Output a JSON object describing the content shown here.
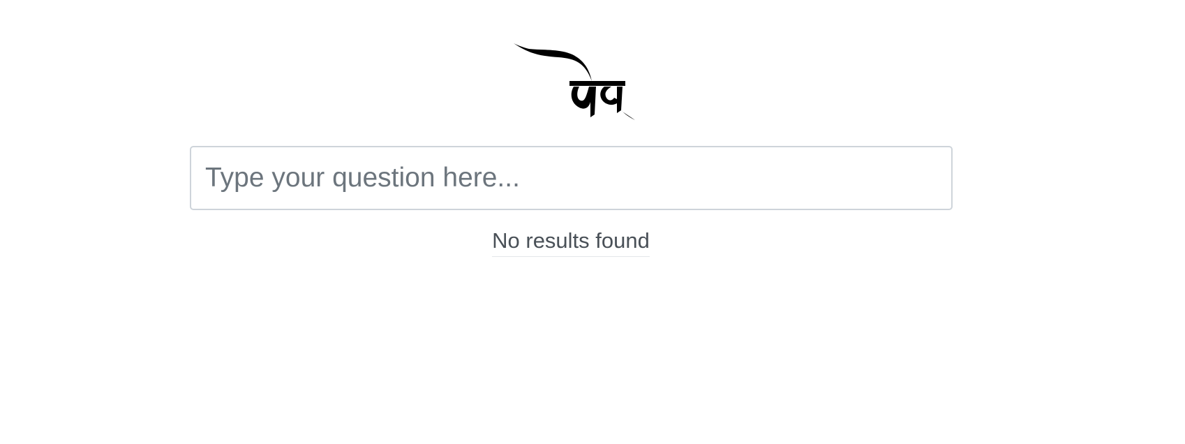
{
  "logo": {
    "text": "वेद",
    "color": "#000000"
  },
  "search": {
    "value": "",
    "placeholder": "Type your question here..."
  },
  "results": {
    "status_text": "No results found"
  },
  "colors": {
    "input_border": "#ced4da",
    "placeholder": "#6c757d",
    "status_text": "#495057"
  }
}
